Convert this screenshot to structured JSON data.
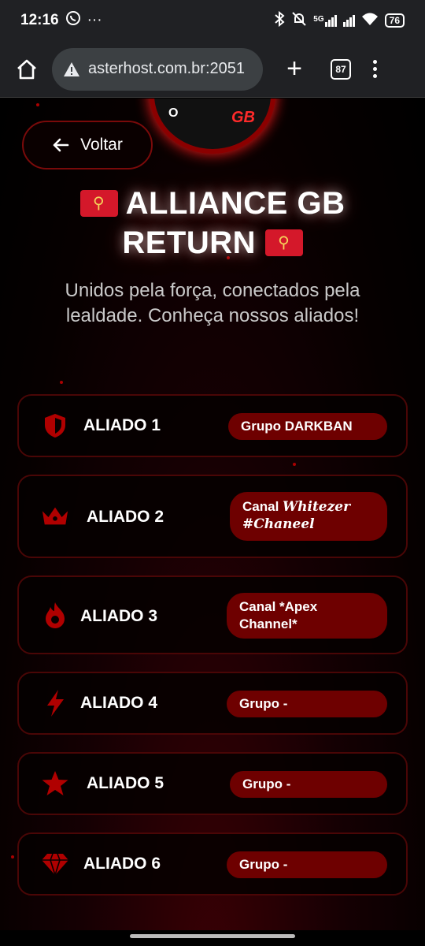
{
  "status_bar": {
    "time": "12:16",
    "signal_label": "5G",
    "battery": "76"
  },
  "browser": {
    "url": "asterhost.com.br:2051",
    "tab_count": "87"
  },
  "page": {
    "back_label": "Voltar",
    "logo_text_gb": "GB",
    "logo_text_o": "O",
    "title_line1": "ALLIANCE GB",
    "title_line2": "RETURN",
    "subtitle": "Unidos pela força, conectados pela lealdade. Conheça nossos aliados!",
    "allies": [
      {
        "name": "ALIADO 1",
        "badge": "Grupo DARKBAN",
        "icon": "shield-icon"
      },
      {
        "name": "ALIADO 2",
        "badge_prefix": "Canal ",
        "badge_script": "Whitezer #Chaneel",
        "icon": "crown-icon"
      },
      {
        "name": "ALIADO 3",
        "badge": "Canal *Apex Channel*",
        "icon": "fire-icon"
      },
      {
        "name": "ALIADO 4",
        "badge": "Grupo -",
        "icon": "bolt-icon"
      },
      {
        "name": "ALIADO 5",
        "badge": "Grupo -",
        "icon": "star-icon"
      },
      {
        "name": "ALIADO 6",
        "badge": "Grupo -",
        "icon": "gem-icon"
      }
    ]
  },
  "colors": {
    "accent": "#b00000",
    "badge_bg": "#6e0000",
    "card_border": "#4a0606"
  }
}
